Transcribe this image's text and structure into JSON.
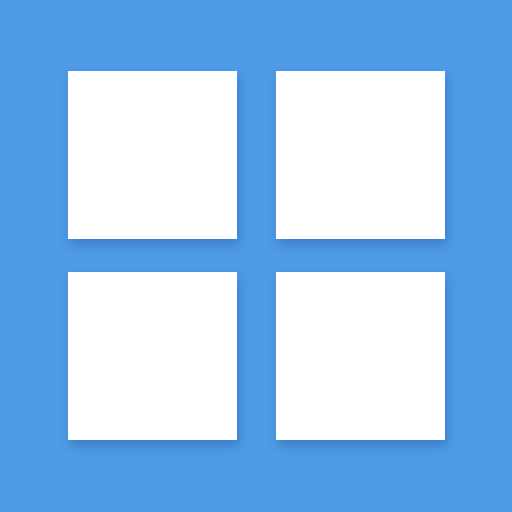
{
  "icon": {
    "name": "grid-icon",
    "background_color": "#4f9be8",
    "tile_color": "#ffffff",
    "tiles": [
      {
        "name": "grid-tile-top-left"
      },
      {
        "name": "grid-tile-top-right"
      },
      {
        "name": "grid-tile-bottom-left"
      },
      {
        "name": "grid-tile-bottom-right"
      }
    ]
  }
}
